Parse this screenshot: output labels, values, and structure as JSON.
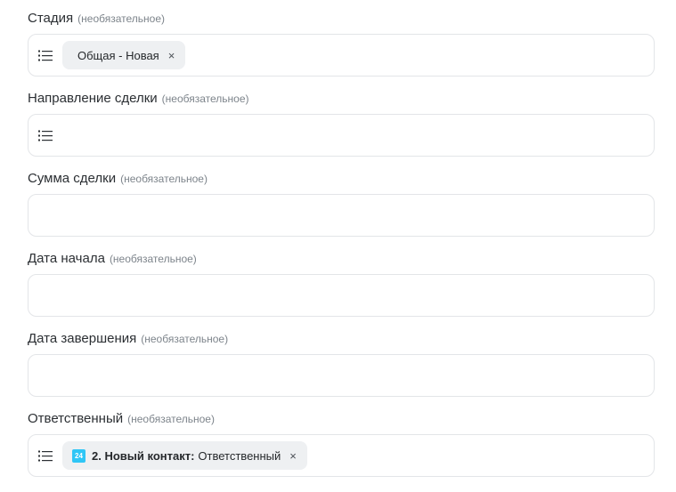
{
  "optional_text": "(необязательное)",
  "fields": [
    {
      "label": "Стадия",
      "chip": {
        "text": "Общая - Новая"
      }
    },
    {
      "label": "Направление сделки"
    },
    {
      "label": "Сумма сделки"
    },
    {
      "label": "Дата начала"
    },
    {
      "label": "Дата завершения"
    },
    {
      "label": "Ответственный",
      "chip": {
        "app_badge": "24",
        "bold": "2. Новый контакт:",
        "text": "Ответственный"
      }
    }
  ],
  "chip_remove_glyph": "×",
  "icons": {
    "menu": "list-icon",
    "remove": "close-icon"
  },
  "colors": {
    "app_badge": "#2fc6f6",
    "chip_bg": "#eef0f2",
    "border": "#e3e5e8"
  }
}
